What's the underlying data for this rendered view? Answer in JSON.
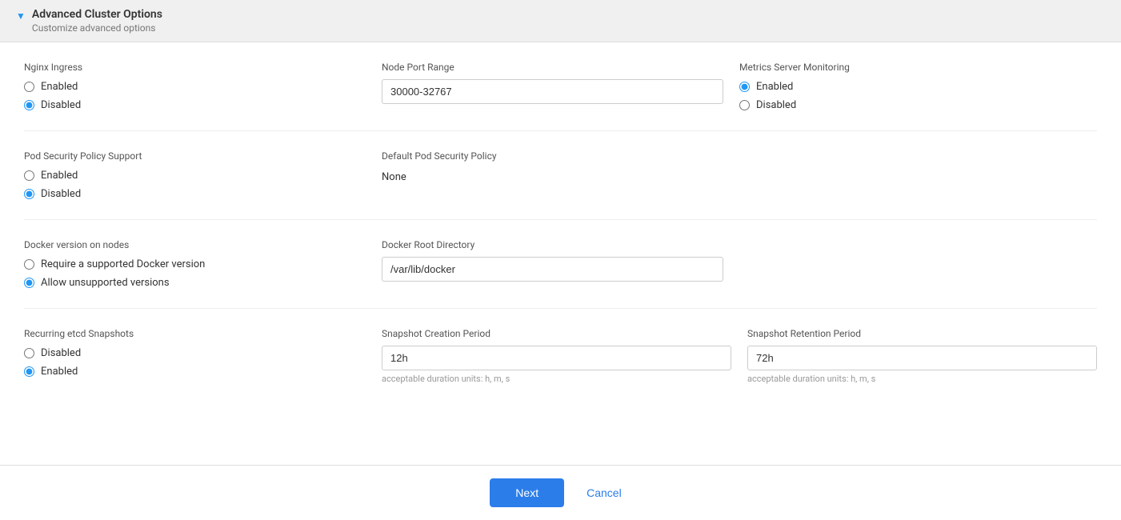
{
  "header": {
    "title": "Advanced Cluster Options",
    "subtitle": "Customize advanced options",
    "chevron": "▼"
  },
  "sections": {
    "nginx_ingress": {
      "label": "Nginx Ingress",
      "options": [
        "Enabled",
        "Disabled"
      ],
      "selected": "Disabled"
    },
    "node_port_range": {
      "label": "Node Port Range",
      "value": "30000-32767"
    },
    "metrics_server": {
      "label": "Metrics Server Monitoring",
      "options": [
        "Enabled",
        "Disabled"
      ],
      "selected": "Enabled"
    },
    "pod_security_policy": {
      "label": "Pod Security Policy Support",
      "options": [
        "Enabled",
        "Disabled"
      ],
      "selected": "Disabled"
    },
    "default_pod_security": {
      "label": "Default Pod Security Policy",
      "value": "None"
    },
    "docker_version": {
      "label": "Docker version on nodes",
      "options": [
        "Require a supported Docker version",
        "Allow unsupported versions"
      ],
      "selected": "Allow unsupported versions"
    },
    "docker_root": {
      "label": "Docker Root Directory",
      "value": "/var/lib/docker"
    },
    "recurring_etcd": {
      "label": "Recurring etcd Snapshots",
      "options": [
        "Disabled",
        "Enabled"
      ],
      "selected": "Enabled"
    },
    "snapshot_creation": {
      "label": "Snapshot Creation Period",
      "value": "12h",
      "hint": "acceptable duration units: h, m, s"
    },
    "snapshot_retention": {
      "label": "Snapshot Retention Period",
      "value": "72h",
      "hint": "acceptable duration units: h, m, s"
    }
  },
  "footer": {
    "next_label": "Next",
    "cancel_label": "Cancel"
  }
}
